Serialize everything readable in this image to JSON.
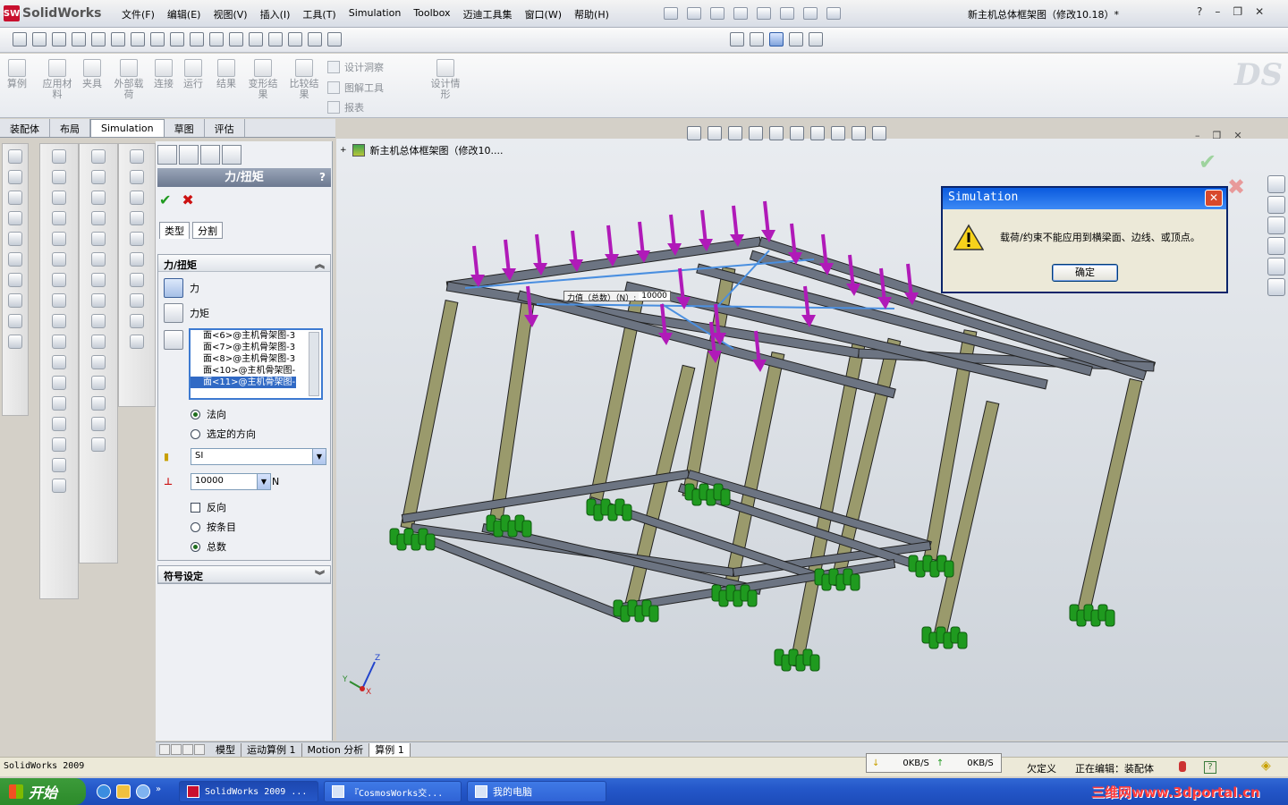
{
  "app": {
    "name": "SolidWorks",
    "window_title": "新主机总体框架图（修改10.18）*"
  },
  "menu": [
    "文件(F)",
    "编辑(E)",
    "视图(V)",
    "插入(I)",
    "工具(T)",
    "Simulation",
    "Toolbox",
    "迈迪工具集",
    "窗口(W)",
    "帮助(H)"
  ],
  "window_buttons": [
    "?",
    "–",
    "❐",
    "✕"
  ],
  "command_manager": {
    "buttons": [
      "算例",
      "应用材料",
      "夹具",
      "外部载荷",
      "连接",
      "运行",
      "结果",
      "变形结果",
      "比较结果",
      "设计情形"
    ],
    "small_buttons": [
      "设计洞察",
      "图解工具",
      "报表"
    ]
  },
  "tabs": [
    "装配体",
    "布局",
    "Simulation",
    "草图",
    "评估"
  ],
  "active_tab": "Simulation",
  "property_manager": {
    "title": "力/扭矩",
    "help": "?",
    "sub_tabs": [
      "类型",
      "分割"
    ],
    "group_title": "力/扭矩",
    "options": {
      "force": "力",
      "torque": "力矩"
    },
    "faces": [
      "面<6>@主机骨架图-3",
      "面<7>@主机骨架图-3",
      "面<8>@主机骨架图-3",
      "面<10>@主机骨架图-",
      "面<11>@主机骨架图-"
    ],
    "direction": {
      "normal": "法向",
      "selected": "选定的方向",
      "selected_value": "法向"
    },
    "units": "SI",
    "force_value": "10000",
    "force_unit": "N",
    "reverse": "反向",
    "distribution": {
      "per_item": "按条目",
      "total": "总数",
      "selected_value": "总数"
    },
    "symbol_group": "符号设定"
  },
  "graphics": {
    "tree_label": "新主机总体框架图（修改10....",
    "callout": "力值（总数）（N）:",
    "callout_value": "10000",
    "triad": {
      "x": "X",
      "y": "Y",
      "z": "Z"
    }
  },
  "dialog": {
    "title": "Simulation",
    "message": "载荷/约束不能应用到横梁面、边线、或顶点。",
    "ok": "确定"
  },
  "bottom_tabs": [
    "模型",
    "运动算例 1",
    "Motion 分析",
    "算例 1"
  ],
  "active_bottom_tab": "算例 1",
  "status": {
    "version": "SolidWorks 2009",
    "down": "0KB/S",
    "up": "0KB/S",
    "underdefined": "欠定义",
    "editing": "正在编辑：装配体"
  },
  "taskbar": {
    "start": "开始",
    "items": [
      "SolidWorks 2009 ...",
      "『CosmosWorks交...",
      "我的电脑"
    ],
    "watermark": "三维网www.3dportal.cn"
  },
  "colors": {
    "load_arrow": "#b01ab8",
    "fixture": "#1f9a1f",
    "column": "#9a9a6c",
    "beam": "#6c7482",
    "dialog_title": "#0a5ade"
  }
}
